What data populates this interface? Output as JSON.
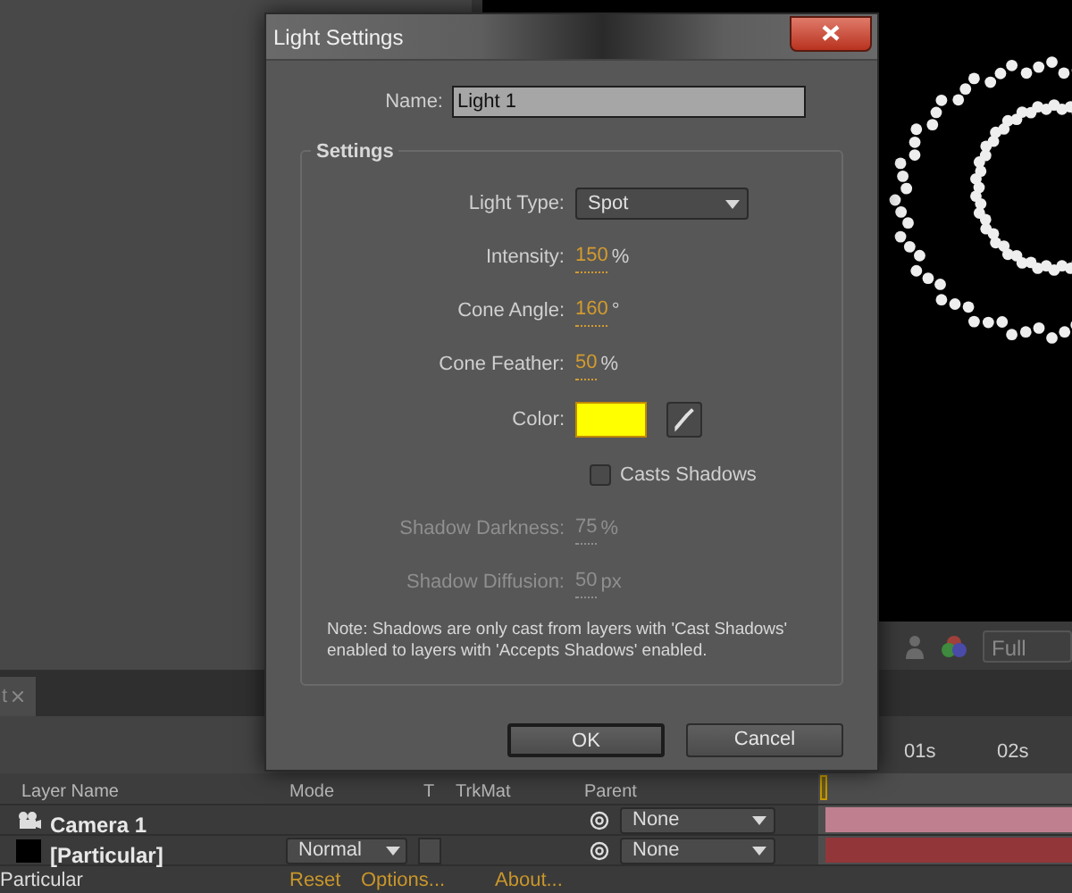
{
  "viewer": {
    "resolution": "Full"
  },
  "timeline": {
    "tab": "t",
    "ruler": [
      "01s",
      "02s"
    ],
    "columns": [
      "Layer Name",
      "Mode",
      "T",
      "TrkMat",
      "Parent"
    ],
    "layers": [
      {
        "kind": "camera",
        "name": "Camera 1",
        "parent": "None",
        "color": "#c07f8f"
      },
      {
        "kind": "solid",
        "name": "[Particular]",
        "mode": "Normal",
        "parent": "None",
        "color": "#93363a"
      }
    ],
    "effect": {
      "name": "Particular",
      "links": [
        "Reset",
        "Options...",
        "About..."
      ]
    }
  },
  "dialog": {
    "title": "Light Settings",
    "name_label": "Name:",
    "name_value": "Light 1",
    "group_title": "Settings",
    "fields": [
      {
        "kind": "dropdown",
        "label": "Light Type:",
        "value": "Spot"
      },
      {
        "kind": "number",
        "label": "Intensity:",
        "value": "150",
        "unit": "%",
        "disabled": false
      },
      {
        "kind": "number",
        "label": "Cone Angle:",
        "value": "160",
        "unit": "°",
        "disabled": false
      },
      {
        "kind": "number",
        "label": "Cone Feather:",
        "value": "50",
        "unit": "%",
        "disabled": false
      },
      {
        "kind": "color",
        "label": "Color:",
        "color": "#ffff00"
      },
      {
        "kind": "checkbox",
        "label": "Casts Shadows",
        "checked": false
      },
      {
        "kind": "number",
        "label": "Shadow Darkness:",
        "value": "75",
        "unit": "%",
        "disabled": true
      },
      {
        "kind": "number",
        "label": "Shadow Diffusion:",
        "value": "50",
        "unit": "px",
        "disabled": true
      }
    ],
    "note": "Note: Shadows are only cast from layers with 'Cast Shadows' enabled to layers with 'Accepts Shadows' enabled.",
    "buttons": [
      {
        "label": "OK",
        "default": true
      },
      {
        "label": "Cancel",
        "default": false
      }
    ]
  }
}
